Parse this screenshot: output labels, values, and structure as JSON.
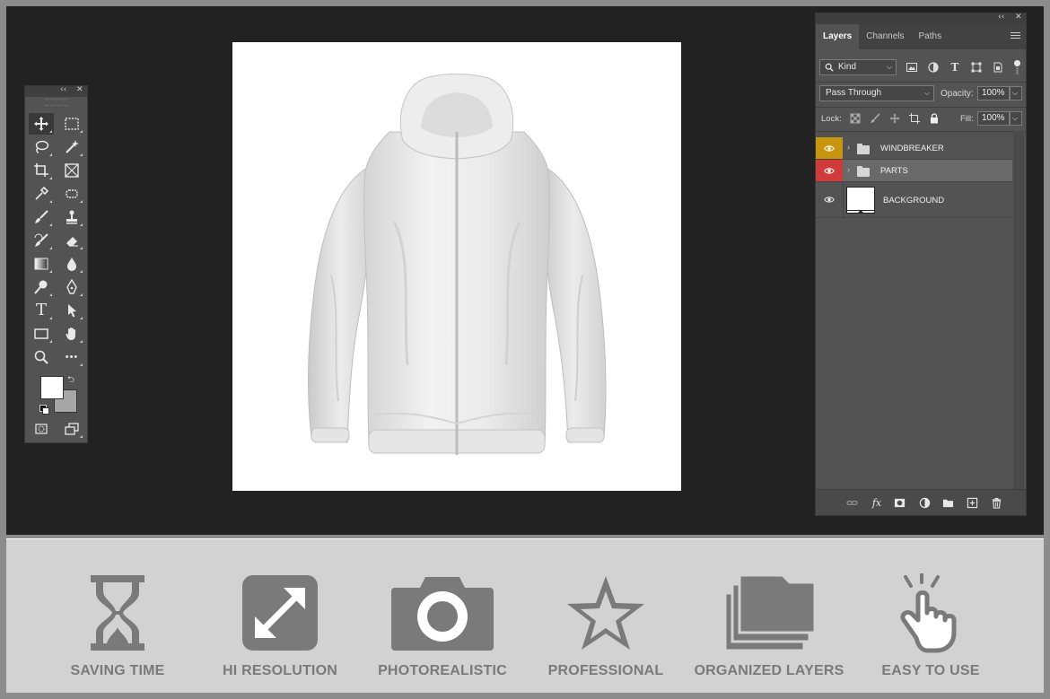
{
  "toolbar": {
    "collapse_glyph": "‹‹",
    "close_glyph": "✕",
    "tools": [
      {
        "name": "move-tool",
        "icon": "move-icon"
      },
      {
        "name": "marquee-tool",
        "icon": "marquee-icon"
      },
      {
        "name": "lasso-tool",
        "icon": "lasso-icon"
      },
      {
        "name": "magic-wand-tool",
        "icon": "magic-wand-icon"
      },
      {
        "name": "crop-tool",
        "icon": "crop-icon"
      },
      {
        "name": "frame-tool",
        "icon": "frame-icon"
      },
      {
        "name": "eyedropper-tool",
        "icon": "eyedropper-icon"
      },
      {
        "name": "healing-brush-tool",
        "icon": "healing-icon"
      },
      {
        "name": "brush-tool",
        "icon": "brush-icon"
      },
      {
        "name": "clone-stamp-tool",
        "icon": "stamp-icon"
      },
      {
        "name": "history-brush-tool",
        "icon": "history-brush-icon"
      },
      {
        "name": "eraser-tool",
        "icon": "eraser-icon"
      },
      {
        "name": "gradient-tool",
        "icon": "gradient-icon"
      },
      {
        "name": "blur-tool",
        "icon": "drop-icon"
      },
      {
        "name": "dodge-tool",
        "icon": "dodge-icon"
      },
      {
        "name": "pen-tool",
        "icon": "pen-icon"
      },
      {
        "name": "type-tool",
        "icon": "type-icon"
      },
      {
        "name": "path-selection-tool",
        "icon": "arrow-icon"
      },
      {
        "name": "rectangle-tool",
        "icon": "rectangle-icon"
      },
      {
        "name": "hand-tool",
        "icon": "hand-icon"
      },
      {
        "name": "zoom-tool",
        "icon": "zoom-icon"
      },
      {
        "name": "more-tools",
        "icon": "more-icon"
      }
    ],
    "type_glyph": "T",
    "more_glyph": "•••",
    "swap_glyph": "⮌"
  },
  "colors": {
    "workspace_bg": "#222222",
    "panel_bg": "#535353",
    "windbreaker_tag": "#c8960c",
    "parts_tag": "#d03a3a",
    "feature_bg": "#d2d2d2",
    "feature_icon": "#7a7a7a"
  },
  "layers_panel": {
    "collapse_glyph": "‹‹",
    "close_glyph": "✕",
    "tabs": [
      "Layers",
      "Channels",
      "Paths"
    ],
    "filter_kind": "Kind",
    "blend_mode": "Pass Through",
    "opacity_label": "Opacity:",
    "opacity_value": "100%",
    "lock_label": "Lock:",
    "fill_label": "Fill:",
    "fill_value": "100%",
    "layers": [
      {
        "name": "WINDBREAKER",
        "type": "group",
        "tag_color": "#c8960c",
        "selected": false
      },
      {
        "name": "PARTS",
        "type": "group",
        "tag_color": "#d03a3a",
        "selected": true
      },
      {
        "name": "BACKGROUND",
        "type": "pixel",
        "tag_color": "",
        "selected": false
      }
    ],
    "expand_glyph": "›",
    "footer_icons": [
      "link-icon",
      "fx-icon",
      "mask-icon",
      "adjustment-icon",
      "group-icon",
      "new-layer-icon",
      "trash-icon"
    ],
    "fx_glyph": "fx"
  },
  "features": [
    {
      "label": "SAVING TIME",
      "icon": "hourglass-icon"
    },
    {
      "label": "HI RESOLUTION",
      "icon": "expand-icon"
    },
    {
      "label": "PHOTOREALISTIC",
      "icon": "camera-icon"
    },
    {
      "label": "PROFESSIONAL",
      "icon": "star-icon"
    },
    {
      "label": "ORGANIZED LAYERS",
      "icon": "layers-icon"
    },
    {
      "label": "EASY TO USE",
      "icon": "hand-tap-icon"
    }
  ]
}
